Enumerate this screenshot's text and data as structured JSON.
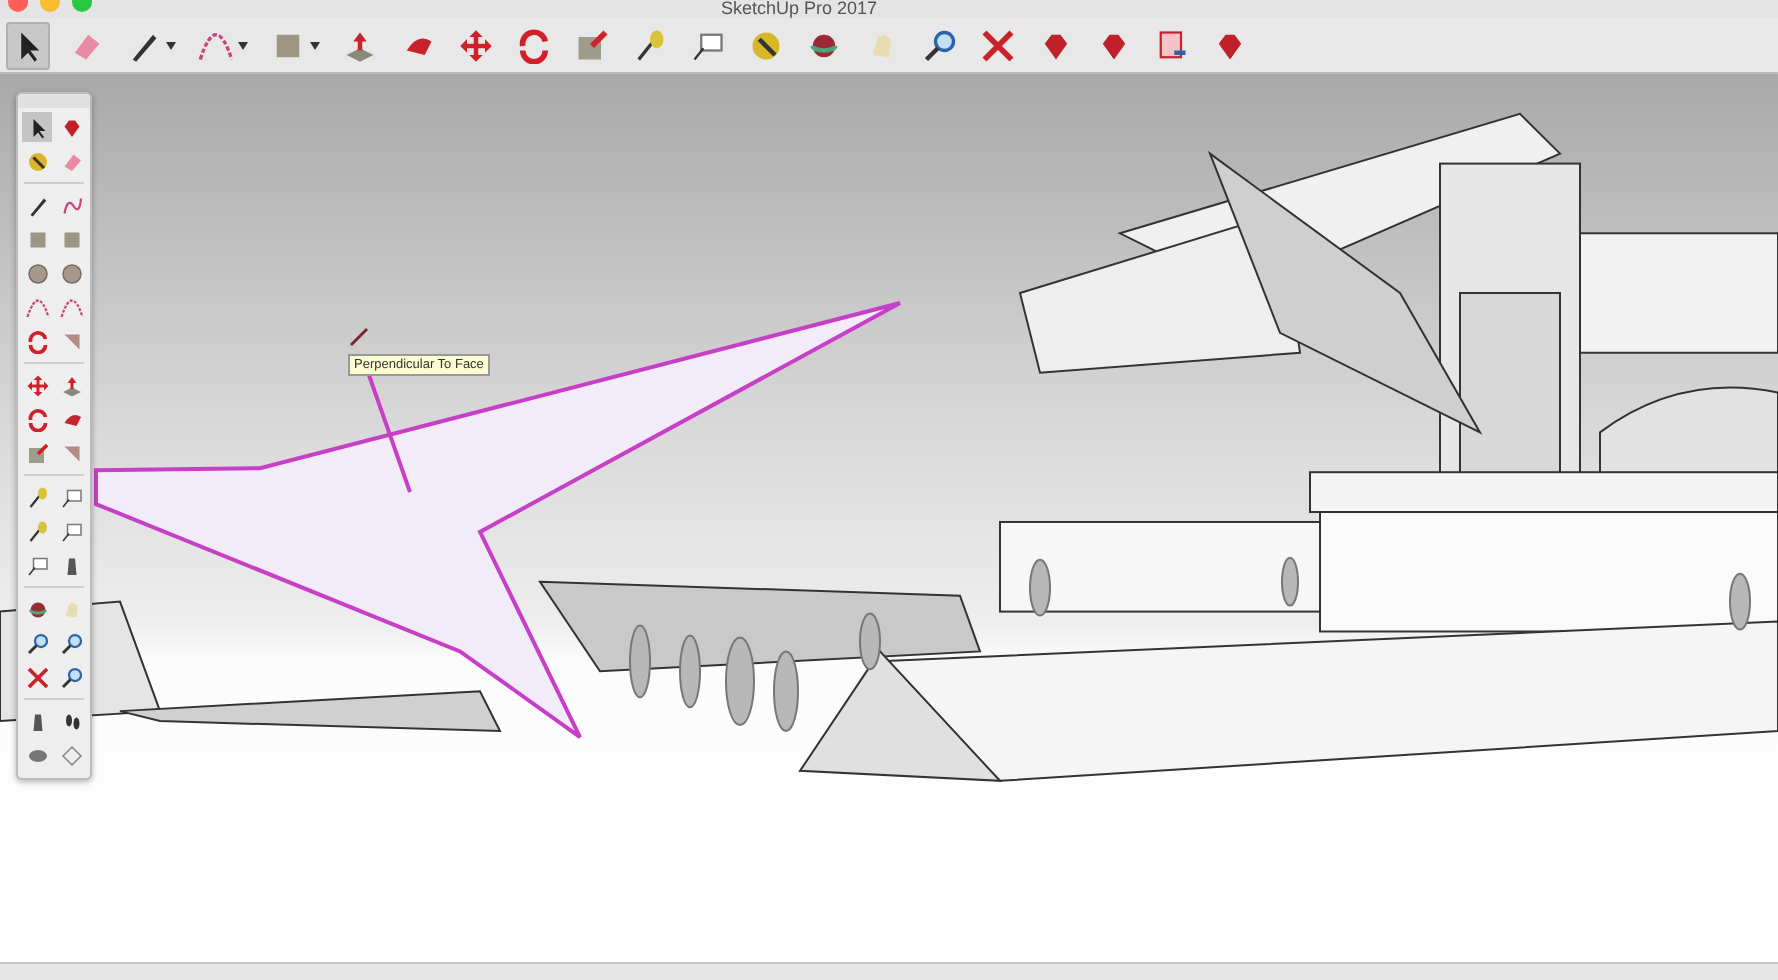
{
  "window": {
    "title": "SketchUp Pro 2017"
  },
  "toolbar": {
    "tools": [
      {
        "selected": true
      },
      {
        "selected": false
      },
      {
        "selected": false
      },
      {
        "selected": false
      },
      {
        "selected": false
      },
      {
        "selected": false
      },
      {
        "selected": false
      },
      {
        "selected": false
      },
      {
        "selected": false
      },
      {
        "selected": false
      },
      {
        "selected": false
      },
      {
        "selected": false
      },
      {
        "selected": false
      },
      {
        "selected": false
      },
      {
        "selected": false
      },
      {
        "selected": false
      },
      {
        "selected": false
      },
      {
        "selected": false
      },
      {
        "selected": false
      },
      {
        "selected": false
      },
      {
        "selected": false
      }
    ]
  },
  "tool_palette": {
    "tools": [
      {
        "selected": true
      },
      {
        "selected": false
      }
    ]
  },
  "viewport": {
    "tooltip": "Perpendicular To Face"
  }
}
